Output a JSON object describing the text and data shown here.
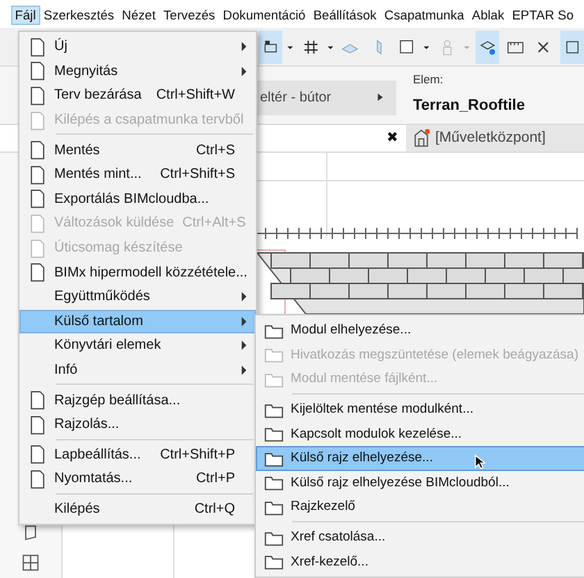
{
  "menubar": [
    {
      "label": "Fájl",
      "selected": true
    },
    {
      "label": "Szerkesztés",
      "selected": false
    },
    {
      "label": "Nézet",
      "selected": false
    },
    {
      "label": "Tervezés",
      "selected": false
    },
    {
      "label": "Dokumentáció",
      "selected": false
    },
    {
      "label": "Beállítások",
      "selected": false
    },
    {
      "label": "Csapatmunka",
      "selected": false
    },
    {
      "label": "Ablak",
      "selected": false
    },
    {
      "label": "EPTAR So",
      "selected": false
    }
  ],
  "info_panel": {
    "category": "eltér - bútor",
    "element_label": "Elem:",
    "element_value": "Terran_Rooftile"
  },
  "tab_bar": {
    "close": "✖",
    "tab": "[Műveletközpont]"
  },
  "file_menu": [
    {
      "kind": "item",
      "label": "Új",
      "submenu": true,
      "disabled": false,
      "selected": false,
      "has_icon": true
    },
    {
      "kind": "item",
      "label": "Megnyitás",
      "submenu": true,
      "disabled": false,
      "selected": false,
      "has_icon": true
    },
    {
      "kind": "item",
      "label": "Terv bezárása",
      "shortcut": "Ctrl+Shift+W",
      "submenu": false,
      "disabled": false,
      "selected": false,
      "has_icon": true
    },
    {
      "kind": "item",
      "label": "Kilépés a csapatmunka tervből",
      "submenu": false,
      "disabled": true,
      "selected": false,
      "has_icon": true
    },
    {
      "kind": "separator"
    },
    {
      "kind": "item",
      "label": "Mentés",
      "shortcut": "Ctrl+S",
      "submenu": false,
      "disabled": false,
      "selected": false,
      "has_icon": true
    },
    {
      "kind": "item",
      "label": "Mentés mint...",
      "shortcut": "Ctrl+Shift+S",
      "submenu": false,
      "disabled": false,
      "selected": false,
      "has_icon": true
    },
    {
      "kind": "item",
      "label": "Exportálás BIMcloudba...",
      "submenu": false,
      "disabled": false,
      "selected": false,
      "has_icon": true
    },
    {
      "kind": "item",
      "label": "Változások küldése",
      "shortcut": "Ctrl+Alt+S",
      "submenu": false,
      "disabled": true,
      "selected": false,
      "has_icon": true
    },
    {
      "kind": "item",
      "label": "Úticsomag készítése",
      "submenu": false,
      "disabled": true,
      "selected": false,
      "has_icon": true
    },
    {
      "kind": "item",
      "label": "BIMx hipermodell közzététele...",
      "submenu": false,
      "disabled": false,
      "selected": false,
      "has_icon": true
    },
    {
      "kind": "item",
      "label": "Együttműködés",
      "submenu": true,
      "disabled": false,
      "selected": false,
      "has_icon": false
    },
    {
      "kind": "item",
      "label": "Külső tartalom",
      "submenu": true,
      "disabled": false,
      "selected": true,
      "has_icon": false
    },
    {
      "kind": "item",
      "label": "Könyvtári elemek",
      "submenu": true,
      "disabled": false,
      "selected": false,
      "has_icon": false
    },
    {
      "kind": "item",
      "label": "Infó",
      "submenu": true,
      "disabled": false,
      "selected": false,
      "has_icon": false
    },
    {
      "kind": "separator"
    },
    {
      "kind": "item",
      "label": "Rajzgép beállítása...",
      "submenu": false,
      "disabled": false,
      "selected": false,
      "has_icon": true
    },
    {
      "kind": "item",
      "label": "Rajzolás...",
      "submenu": false,
      "disabled": false,
      "selected": false,
      "has_icon": true
    },
    {
      "kind": "separator"
    },
    {
      "kind": "item",
      "label": "Lapbeállítás...",
      "shortcut": "Ctrl+Shift+P",
      "submenu": false,
      "disabled": false,
      "selected": false,
      "has_icon": true
    },
    {
      "kind": "item",
      "label": "Nyomtatás...",
      "shortcut": "Ctrl+P",
      "submenu": false,
      "disabled": false,
      "selected": false,
      "has_icon": true
    },
    {
      "kind": "separator"
    },
    {
      "kind": "item",
      "label": "Kilépés",
      "shortcut": "Ctrl+Q",
      "submenu": false,
      "disabled": false,
      "selected": false,
      "has_icon": false
    }
  ],
  "submenu": [
    {
      "kind": "item",
      "label": "Modul elhelyezése...",
      "disabled": false,
      "selected": false
    },
    {
      "kind": "item",
      "label": "Hivatkozás megszüntetése (elemek beágyazása)",
      "disabled": true,
      "selected": false
    },
    {
      "kind": "item",
      "label": "Modul mentése fájlként...",
      "disabled": true,
      "selected": false
    },
    {
      "kind": "separator"
    },
    {
      "kind": "item",
      "label": "Kijelöltek mentése modulként...",
      "disabled": false,
      "selected": false
    },
    {
      "kind": "item",
      "label": "Kapcsolt modulok kezelése...",
      "disabled": false,
      "selected": false
    },
    {
      "kind": "item",
      "label": "Külső rajz elhelyezése...",
      "disabled": false,
      "selected": true
    },
    {
      "kind": "item",
      "label": "Külső rajz elhelyezése BIMcloudból...",
      "disabled": false,
      "selected": false
    },
    {
      "kind": "item",
      "label": "Rajzkezelő",
      "disabled": false,
      "selected": false
    },
    {
      "kind": "separator"
    },
    {
      "kind": "item",
      "label": "Xref csatolása...",
      "disabled": false,
      "selected": false
    },
    {
      "kind": "item",
      "label": "Xref-kezelő...",
      "disabled": false,
      "selected": false
    }
  ]
}
